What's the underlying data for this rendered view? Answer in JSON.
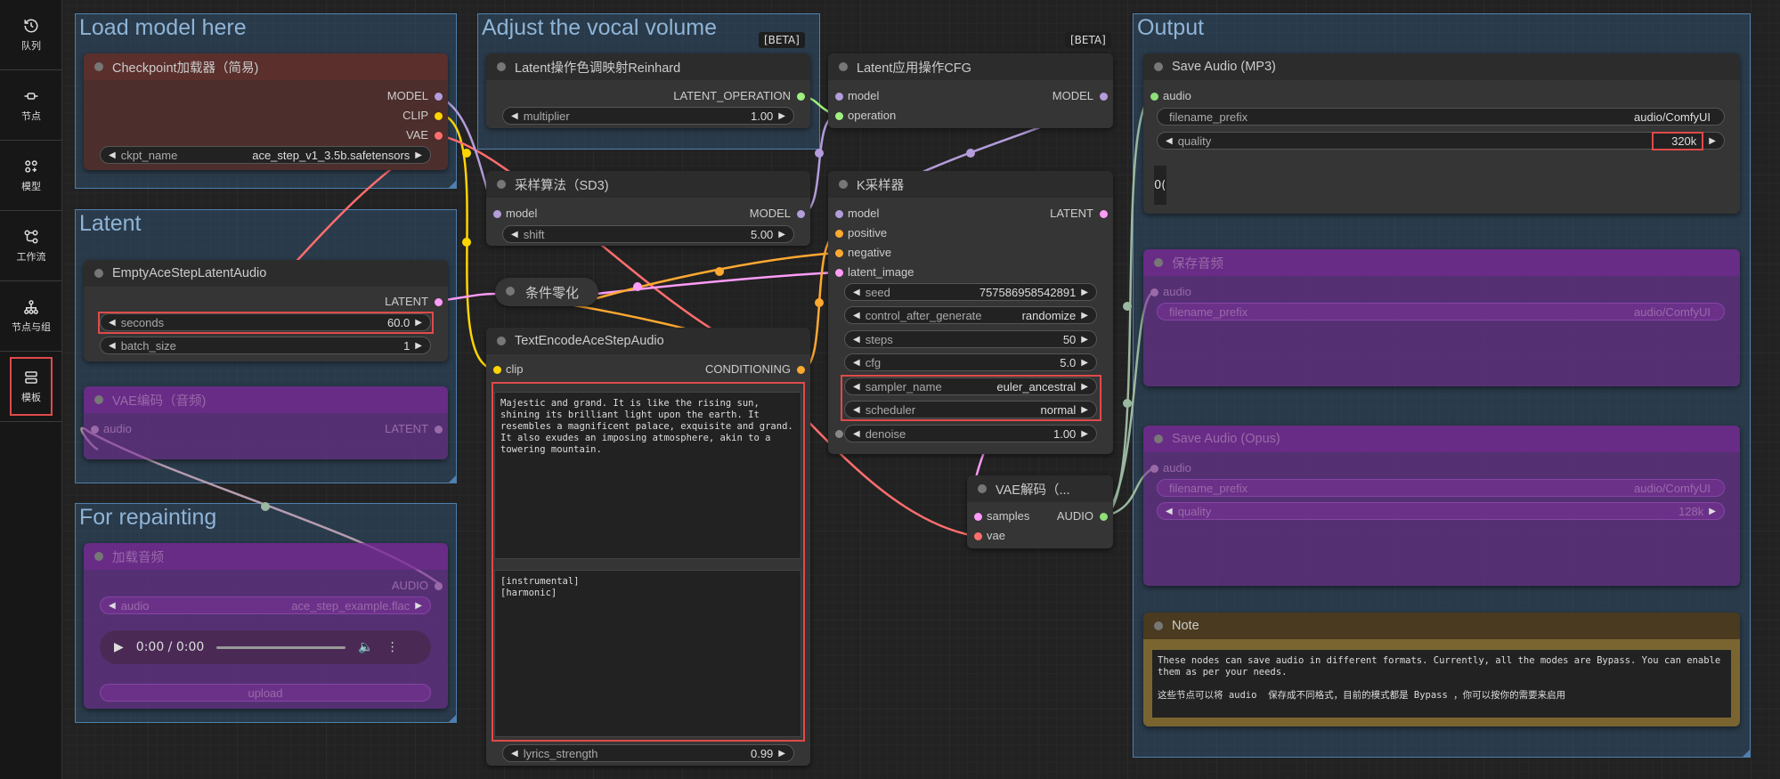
{
  "sidebar": {
    "items": [
      {
        "label": "队列",
        "icon": "history-icon"
      },
      {
        "label": "节点",
        "icon": "node-icon"
      },
      {
        "label": "模型",
        "icon": "model-icon"
      },
      {
        "label": "工作流",
        "icon": "workflow-icon"
      },
      {
        "label": "节点与组",
        "icon": "node-library-icon"
      },
      {
        "label": "模板",
        "icon": "template-icon"
      }
    ]
  },
  "groups": {
    "load_model": "Load model here",
    "latent": "Latent",
    "repainting": "For repainting",
    "vocal": "Adjust the vocal volume",
    "output": "Output"
  },
  "nodes": {
    "checkpoint": {
      "title": "Checkpoint加载器（简易)",
      "out_model": "MODEL",
      "out_clip": "CLIP",
      "out_vae": "VAE",
      "ckpt_label": "ckpt_name",
      "ckpt_value": "ace_step_v1_3.5b.safetensors"
    },
    "empty_latent": {
      "title": "EmptyAceStepLatentAudio",
      "out_latent": "LATENT",
      "seconds_label": "seconds",
      "seconds_value": "60.0",
      "batch_label": "batch_size",
      "batch_value": "1"
    },
    "vae_encode": {
      "title": "VAE编码（音频)",
      "in_audio": "audio",
      "out_latent": "LATENT"
    },
    "load_audio": {
      "title": "加载音频",
      "out_audio": "AUDIO",
      "audio_label": "audio",
      "audio_value": "ace_step_example.flac",
      "time": "0:00 / 0:00",
      "upload": "upload"
    },
    "reinhard": {
      "title": "Latent操作色调映射Reinhard",
      "badge": "[BETA]",
      "out": "LATENT_OPERATION",
      "mult_label": "multiplier",
      "mult_value": "1.00"
    },
    "cfg_op": {
      "title": "Latent应用操作CFG",
      "badge": "[BETA]",
      "in_model": "model",
      "in_op": "operation",
      "out_model": "MODEL"
    },
    "sd3": {
      "title": "采样算法（SD3)",
      "in_model": "model",
      "out_model": "MODEL",
      "shift_label": "shift",
      "shift_value": "5.00"
    },
    "zero_cond": {
      "title": "条件零化"
    },
    "text_encode": {
      "title": "TextEncodeAceStepAudio",
      "in_clip": "clip",
      "out_cond": "CONDITIONING",
      "tags": "Majestic and grand. It is like the rising sun, shining its brilliant light upon the earth. It resembles a magnificent palace, exquisite and grand. It also exudes an imposing atmosphere, akin to a towering mountain.",
      "lyrics": "[instrumental]\n[harmonic]",
      "lyrics_label": "lyrics_strength",
      "lyrics_value": "0.99"
    },
    "ksampler": {
      "title": "K采样器",
      "in_model": "model",
      "in_pos": "positive",
      "in_neg": "negative",
      "in_latent": "latent_image",
      "out_latent": "LATENT",
      "seed_label": "seed",
      "seed_value": "757586958542891",
      "cag_label": "control_after_generate",
      "cag_value": "randomize",
      "steps_label": "steps",
      "steps_value": "50",
      "cfg_label": "cfg",
      "cfg_value": "5.0",
      "sampler_label": "sampler_name",
      "sampler_value": "euler_ancestral",
      "sched_label": "scheduler",
      "sched_value": "normal",
      "denoise_label": "denoise",
      "denoise_value": "1.00"
    },
    "vae_decode": {
      "title": "VAE解码（...",
      "in_samples": "samples",
      "in_vae": "vae",
      "out_audio": "AUDIO"
    },
    "save_mp3": {
      "title": "Save Audio (MP3)",
      "in_audio": "audio",
      "prefix_label": "filename_prefix",
      "prefix_value": "audio/ComfyUI",
      "quality_label": "quality",
      "quality_value": "320k",
      "preview": "0("
    },
    "save_flac": {
      "title": "保存音频",
      "in_audio": "audio",
      "prefix_label": "filename_prefix",
      "prefix_value": "audio/ComfyUI"
    },
    "save_opus": {
      "title": "Save Audio (Opus)",
      "in_audio": "audio",
      "prefix_label": "filename_prefix",
      "prefix_value": "audio/ComfyUI",
      "quality_label": "quality",
      "quality_value": "128k"
    },
    "note": {
      "title": "Note",
      "text": "These nodes can save audio in different formats. Currently, all the modes are Bypass. You can enable them as per your needs.\n\n这些节点可以将 audio  保存成不同格式，目前的模式都是 Bypass ，你可以按你的需要来启用"
    }
  },
  "colors": {
    "clip": "#ffd500",
    "vae": "#ff6e6e",
    "model": "#b39ddb",
    "latent": "#ff9cf9",
    "conditioning": "#ffa931",
    "audio": "#9bb8a0",
    "latent_op": "#a0f080",
    "highlight": "#e04a4a"
  }
}
